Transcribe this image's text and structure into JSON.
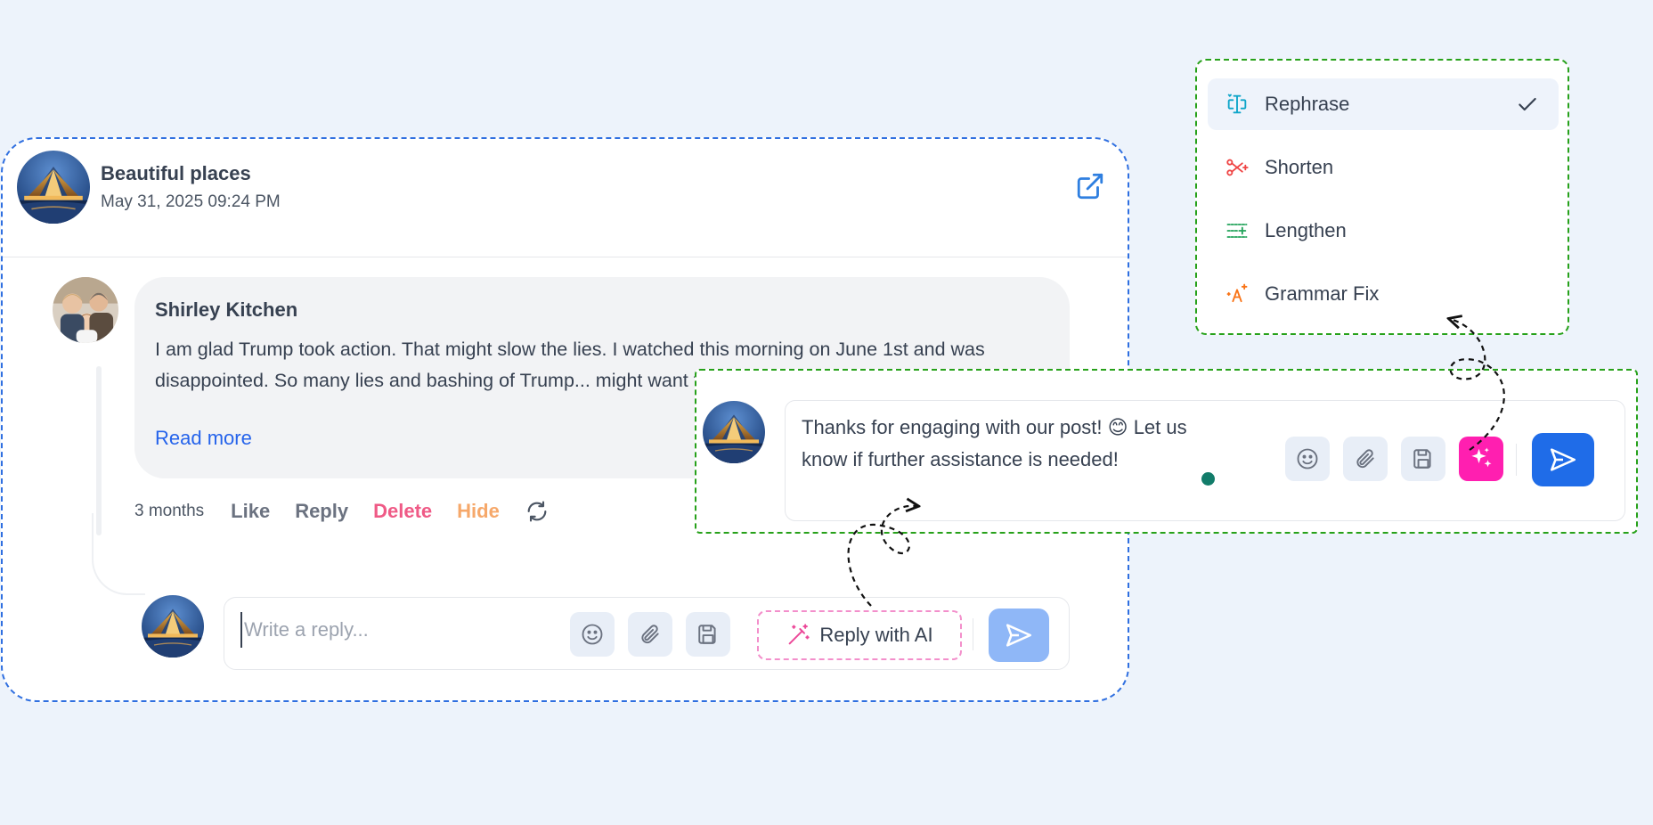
{
  "post": {
    "title": "Beautiful places",
    "date": "May 31, 2025 09:24 PM"
  },
  "comment": {
    "author": "Shirley Kitchen",
    "text": "I am glad Trump took action. That might slow the lies. I watched this morning on June 1st and was disappointed. So many lies and bashing of Trump... might want to clean house...",
    "read_more": "Read more",
    "time": "3 months",
    "actions": {
      "like": "Like",
      "reply": "Reply",
      "delete": "Delete",
      "hide": "Hide"
    }
  },
  "reply": {
    "placeholder": "Write a reply...",
    "ai_button": "Reply with AI"
  },
  "compose": {
    "text": "Thanks for engaging with our post! 😊 Let us know if further assistance is needed!"
  },
  "rewrite_menu": {
    "items": [
      {
        "label": "Rephrase",
        "icon": "rephrase-icon",
        "selected": true
      },
      {
        "label": "Shorten",
        "icon": "shorten-icon",
        "selected": false
      },
      {
        "label": "Lengthen",
        "icon": "lengthen-icon",
        "selected": false
      },
      {
        "label": "Grammar Fix",
        "icon": "grammar-fix-icon",
        "selected": false
      }
    ]
  },
  "colors": {
    "background": "#edf3fb",
    "card_border": "#2f6fe0",
    "highlight_border": "#27a11a",
    "link": "#2563eb",
    "delete": "#ef5a86",
    "hide": "#f6a86a",
    "ai_accent": "#ff1fb0",
    "send_active": "#1f6ce8",
    "send_disabled": "#8fb7f7"
  }
}
